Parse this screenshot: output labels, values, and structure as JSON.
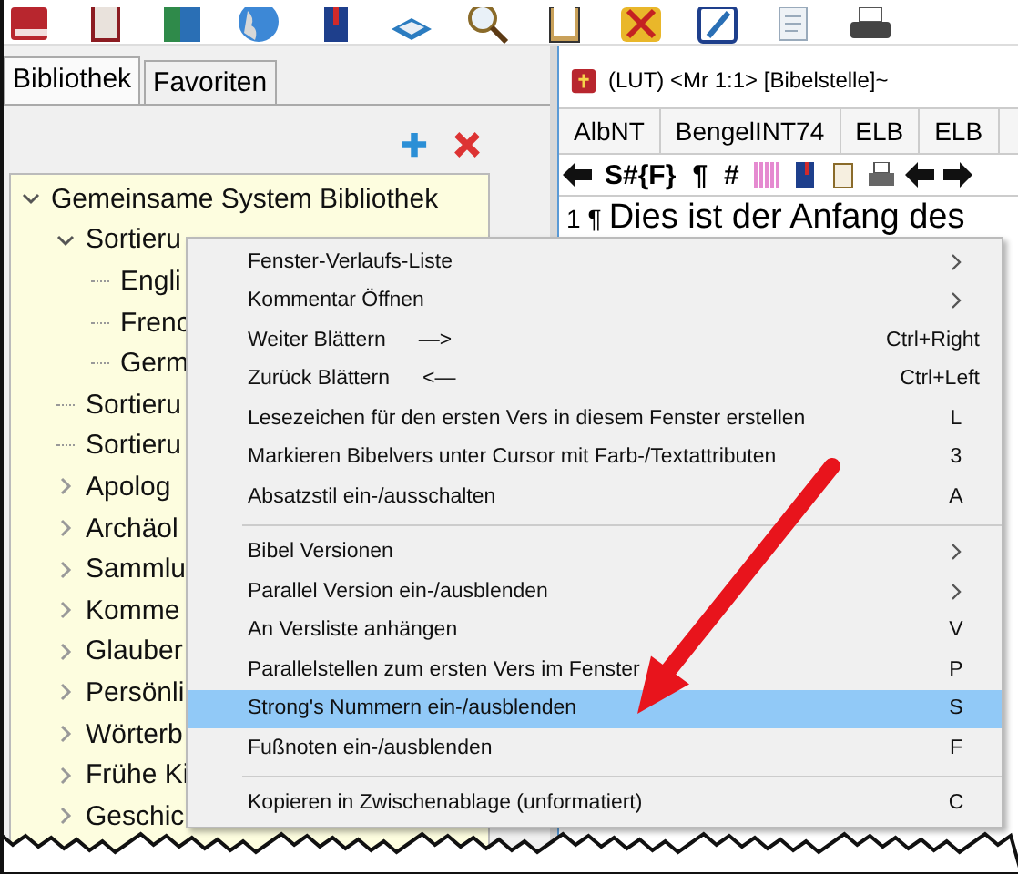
{
  "library_tabs": [
    {
      "label": "Bibliothek",
      "selected": true
    },
    {
      "label": "Favoriten",
      "selected": false
    }
  ],
  "tree": {
    "items": [
      {
        "label": "Gemeinsame System Bibliothek",
        "expanded": true,
        "children": [
          {
            "label": "Sortieru",
            "expanded": true,
            "children": [
              {
                "label": "Engli"
              },
              {
                "label": "Frenc"
              },
              {
                "label": "Germ"
              }
            ]
          },
          {
            "label": "Sortieru"
          },
          {
            "label": "Sortieru"
          },
          {
            "label": "Apolog",
            "expanded": false
          },
          {
            "label": "Archäol",
            "expanded": false
          },
          {
            "label": "Sammlu",
            "expanded": false
          },
          {
            "label": "Komme",
            "expanded": false
          },
          {
            "label": "Glauber",
            "expanded": false
          },
          {
            "label": "Persönli",
            "expanded": false
          },
          {
            "label": "Wörterb",
            "expanded": false
          },
          {
            "label": "Frühe Ki",
            "expanded": false
          },
          {
            "label": "Geschic",
            "expanded": false
          }
        ]
      }
    ]
  },
  "bible_window": {
    "title": "(LUT) <Mr 1:1> [Bibelstelle]~",
    "version_tabs": [
      "AlbNT",
      "BengelINT74",
      "ELB",
      "ELB"
    ],
    "toolbar_texts": [
      "S#{F}",
      "¶",
      "#"
    ],
    "verse_number": "1",
    "verse_mark": "¶",
    "verse_text": "Dies ist der Anfang des"
  },
  "context_menu": {
    "items": [
      {
        "kind": "item",
        "label": "Fenster-Verlaufs-Liste",
        "submenu": true,
        "selected": false
      },
      {
        "kind": "item",
        "label": "Kommentar Öffnen",
        "submenu": true,
        "selected": false
      },
      {
        "kind": "item",
        "label": "Weiter Blättern",
        "hint": "—>",
        "shortcut": "Ctrl+Right",
        "selected": false
      },
      {
        "kind": "item",
        "label": "Zurück Blättern",
        "hint": "<—",
        "shortcut": "Ctrl+Left",
        "selected": false
      },
      {
        "kind": "item",
        "label": "Lesezeichen für den ersten Vers in diesem Fenster erstellen",
        "shortcut": "L",
        "selected": false
      },
      {
        "kind": "item",
        "label": "Markieren Bibelvers unter Cursor mit Farb-/Textattributen",
        "shortcut": "3",
        "selected": false
      },
      {
        "kind": "item",
        "label": "Absatzstil ein-/ausschalten",
        "shortcut": "A",
        "selected": false
      },
      {
        "kind": "separator"
      },
      {
        "kind": "item",
        "label": "Bibel Versionen",
        "submenu": true,
        "selected": false
      },
      {
        "kind": "item",
        "label": "Parallel Version ein-/ausblenden",
        "submenu": true,
        "selected": false
      },
      {
        "kind": "item",
        "label": "An Versliste anhängen",
        "shortcut": "V",
        "selected": false
      },
      {
        "kind": "item",
        "label": "Parallelstellen zum ersten Vers im Fenster",
        "shortcut": "P",
        "selected": false
      },
      {
        "kind": "item",
        "label": "Strong's Nummern ein-/ausblenden",
        "shortcut": "S",
        "selected": true
      },
      {
        "kind": "item",
        "label": "Fußnoten ein-/ausblenden",
        "shortcut": "F",
        "selected": false
      },
      {
        "kind": "separator"
      },
      {
        "kind": "item",
        "label": "Kopieren in Zwischenablage (unformatiert)",
        "shortcut": "C",
        "selected": false
      }
    ]
  }
}
